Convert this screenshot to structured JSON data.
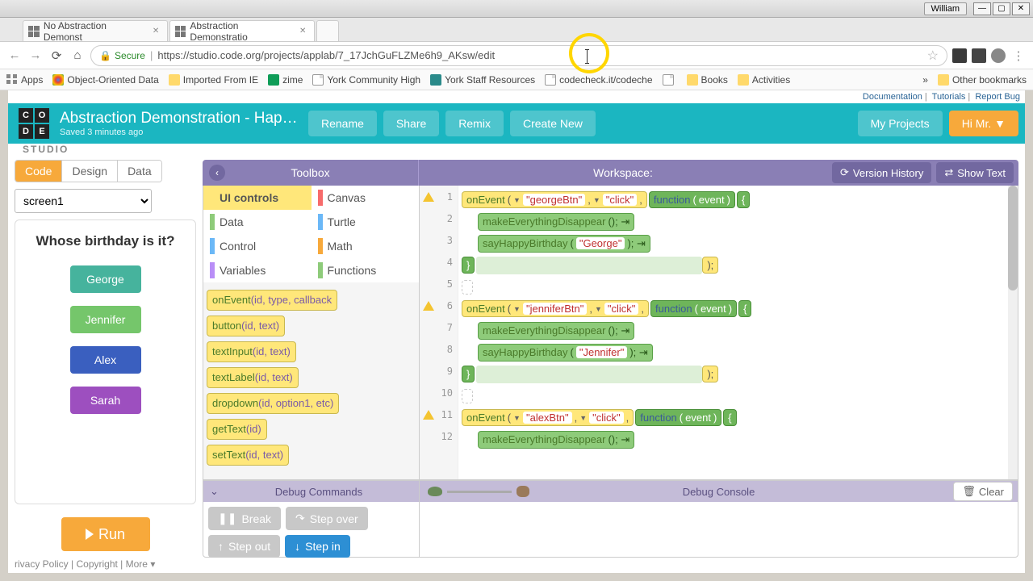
{
  "window": {
    "user": "William"
  },
  "browser": {
    "tabs": [
      {
        "title": "No Abstraction Demonst",
        "active": false
      },
      {
        "title": "Abstraction Demonstratio",
        "active": true
      }
    ],
    "secure_label": "Secure",
    "url": "https://studio.code.org/projects/applab/7_17JchGuFLZMe6h9_AKsw/edit",
    "bookmarks": [
      {
        "label": "Apps"
      },
      {
        "label": "Object-Oriented Data"
      },
      {
        "label": "Imported From IE"
      },
      {
        "label": "zime"
      },
      {
        "label": "York Community High"
      },
      {
        "label": "York Staff Resources"
      },
      {
        "label": "codecheck.it/codeche"
      },
      {
        "label": ""
      },
      {
        "label": "Books"
      },
      {
        "label": "Activities"
      }
    ],
    "more_glyph": "»",
    "other_bookmarks": "Other bookmarks"
  },
  "doclinks": {
    "doc": "Documentation",
    "tut": "Tutorials",
    "bug": "Report Bug"
  },
  "header": {
    "logo_letters": [
      "C",
      "O",
      "D",
      "E"
    ],
    "studio": "STUDIO",
    "title": "Abstraction Demonstration - Happy ...",
    "saved": "Saved 3 minutes ago",
    "rename": "Rename",
    "share": "Share",
    "remix": "Remix",
    "create": "Create New",
    "projects": "My Projects",
    "user": "Hi Mr. ▼"
  },
  "modes": {
    "code": "Code",
    "design": "Design",
    "data": "Data"
  },
  "screen_select": "screen1",
  "phone": {
    "title": "Whose birthday is it?",
    "buttons": [
      {
        "label": "George",
        "color": "#46b39d"
      },
      {
        "label": "Jennifer",
        "color": "#75c66b"
      },
      {
        "label": "Alex",
        "color": "#3a5fbf"
      },
      {
        "label": "Sarah",
        "color": "#9d4fbf"
      }
    ],
    "run": "Run"
  },
  "toolbox": {
    "title": "Toolbox",
    "categories": [
      {
        "name": "UI controls",
        "color": "#ffe77a",
        "active": true
      },
      {
        "name": "Canvas",
        "color": "#f76b6b"
      },
      {
        "name": "Data",
        "color": "#8ecb7a"
      },
      {
        "name": "Turtle",
        "color": "#6bb8f7"
      },
      {
        "name": "Control",
        "color": "#6bb8f7"
      },
      {
        "name": "Math",
        "color": "#f7a93b"
      },
      {
        "name": "Variables",
        "color": "#b98ef7"
      },
      {
        "name": "Functions",
        "color": "#8ecb7a"
      }
    ],
    "blocks": [
      "onEvent(id, type, callback",
      "button(id, text)",
      "textInput(id, text)",
      "textLabel(id, text)",
      "dropdown(id, option1, etc)",
      "getText(id)",
      "setText(id, text)"
    ]
  },
  "workspace": {
    "title": "Workspace:",
    "version": "Version History",
    "showtext": "Show Text",
    "lines": [
      {
        "n": 1,
        "warn": true,
        "type": "onEvent",
        "id": "georgeBtn",
        "evt": "click"
      },
      {
        "n": 2,
        "type": "call",
        "fn": "makeEverythingDisappear",
        "args": ""
      },
      {
        "n": 3,
        "type": "call",
        "fn": "sayHappyBirthday",
        "args": "George"
      },
      {
        "n": 4,
        "type": "close"
      },
      {
        "n": 5,
        "type": "blank"
      },
      {
        "n": 6,
        "warn": true,
        "type": "onEvent",
        "id": "jenniferBtn",
        "evt": "click"
      },
      {
        "n": 7,
        "type": "call",
        "fn": "makeEverythingDisappear",
        "args": ""
      },
      {
        "n": 8,
        "type": "call",
        "fn": "sayHappyBirthday",
        "args": "Jennifer"
      },
      {
        "n": 9,
        "type": "close"
      },
      {
        "n": 10,
        "type": "blank"
      },
      {
        "n": 11,
        "warn": true,
        "type": "onEvent",
        "id": "alexBtn",
        "evt": "click"
      },
      {
        "n": 12,
        "type": "call",
        "fn": "makeEverythingDisappear",
        "args": ""
      }
    ]
  },
  "debug": {
    "left_title": "Debug Commands",
    "right_title": "Debug Console",
    "break": "Break",
    "stepover": "Step over",
    "stepout": "Step out",
    "stepin": "Step in",
    "clear": "Clear"
  },
  "footer": {
    "privacy": "rivacy Policy",
    "copyright": "Copyright",
    "more": "More ▾"
  }
}
